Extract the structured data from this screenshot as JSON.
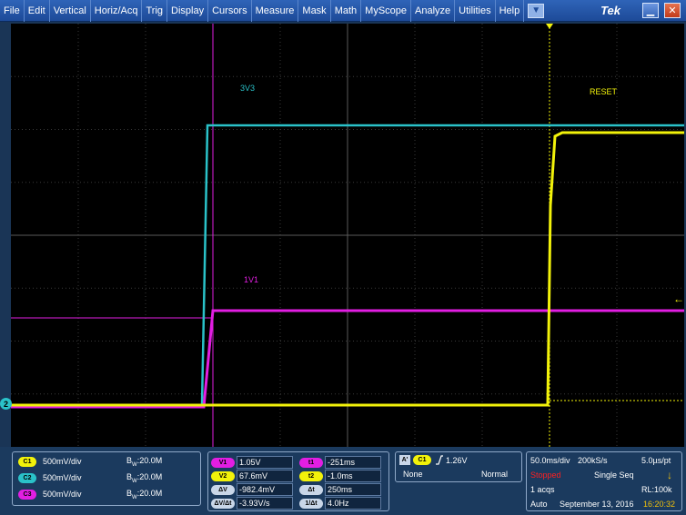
{
  "menu": {
    "items": [
      "File",
      "Edit",
      "Vertical",
      "Horiz/Acq",
      "Trig",
      "Display",
      "Cursors",
      "Measure",
      "Mask",
      "Math",
      "MyScope",
      "Analyze",
      "Utilities",
      "Help"
    ],
    "dropdown_icon": "down-arrow-icon",
    "brand": "Tek"
  },
  "colors": {
    "ch1": "#f2f20a",
    "ch2": "#2ac2c9",
    "ch3": "#e21ee2"
  },
  "waveforms": {
    "label_3v3": "3V3",
    "label_1v1": "1V1",
    "label_reset": "RESET",
    "ch2_marker": "2"
  },
  "channels": [
    {
      "id": "C1",
      "scale": "500mV/div",
      "bw_prefix": "B",
      "bw_sub": "W",
      "bw_value": ":20.0M"
    },
    {
      "id": "C2",
      "scale": "500mV/div",
      "bw_prefix": "B",
      "bw_sub": "W",
      "bw_value": ":20.0M"
    },
    {
      "id": "C3",
      "scale": "500mV/div",
      "bw_prefix": "B",
      "bw_sub": "W",
      "bw_value": ":20.0M"
    }
  ],
  "measurements": {
    "left": [
      {
        "label": "V1",
        "value": "1.05V"
      },
      {
        "label": "V2",
        "value": "67.6mV"
      },
      {
        "label": "ΔV",
        "value": "-982.4mV"
      },
      {
        "label": "ΔV/Δt",
        "value": "-3.93V/s"
      }
    ],
    "right": [
      {
        "label": "t1",
        "value": "-251ms"
      },
      {
        "label": "t2",
        "value": "-1.0ms"
      },
      {
        "label": "Δt",
        "value": "250ms"
      },
      {
        "label": "1/Δt",
        "value": "4.0Hz"
      }
    ]
  },
  "trigger": {
    "mode_badge": "A'",
    "source": "C1",
    "slope_icon": "rising-edge-icon",
    "level": "1.26V",
    "coupling": "None",
    "type": "Normal"
  },
  "acquisition": {
    "timebase": "50.0ms/div",
    "sample_rate": "200kS/s",
    "resolution": "5.0µs/pt",
    "state": "Stopped",
    "mode": "Single Seq",
    "acqs": "1 acqs",
    "record_length": "RL:100k",
    "run_mode": "Auto",
    "date": "September 13, 2016",
    "time": "16:20:32",
    "state_color": "#ff2020",
    "time_color": "#f2c20a"
  }
}
